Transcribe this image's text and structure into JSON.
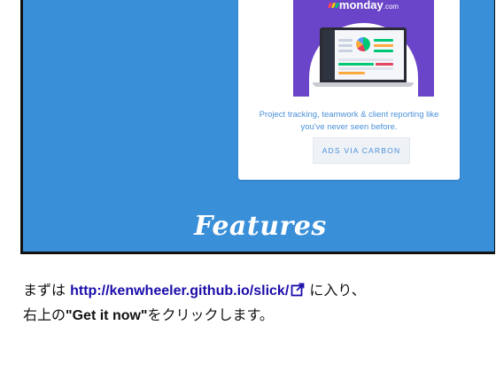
{
  "ad": {
    "brand_logo_text": "monday",
    "brand_logo_suffix": ".com",
    "description": "Project tracking, teamwork & client reporting like you've never seen before.",
    "cta_label": "ADS VIA CARBON"
  },
  "page": {
    "features_heading": "Features"
  },
  "instruction": {
    "line1_prefix": "まずは",
    "link_text": "http://kenwheeler.github.io/slick/",
    "line1_suffix": "に入り、",
    "line2_prefix": "右上の",
    "quoted_button": "\"Get it now\"",
    "line2_suffix": "をクリックします。"
  },
  "colors": {
    "page_background": "#3a8fd9",
    "ad_image_bg": "#6a45c9",
    "link_color": "#1a0dab",
    "ad_text_color": "#4a90d9"
  },
  "icons": {
    "external_link": "external-link-icon",
    "laptop": "laptop-dashboard-illustration"
  }
}
